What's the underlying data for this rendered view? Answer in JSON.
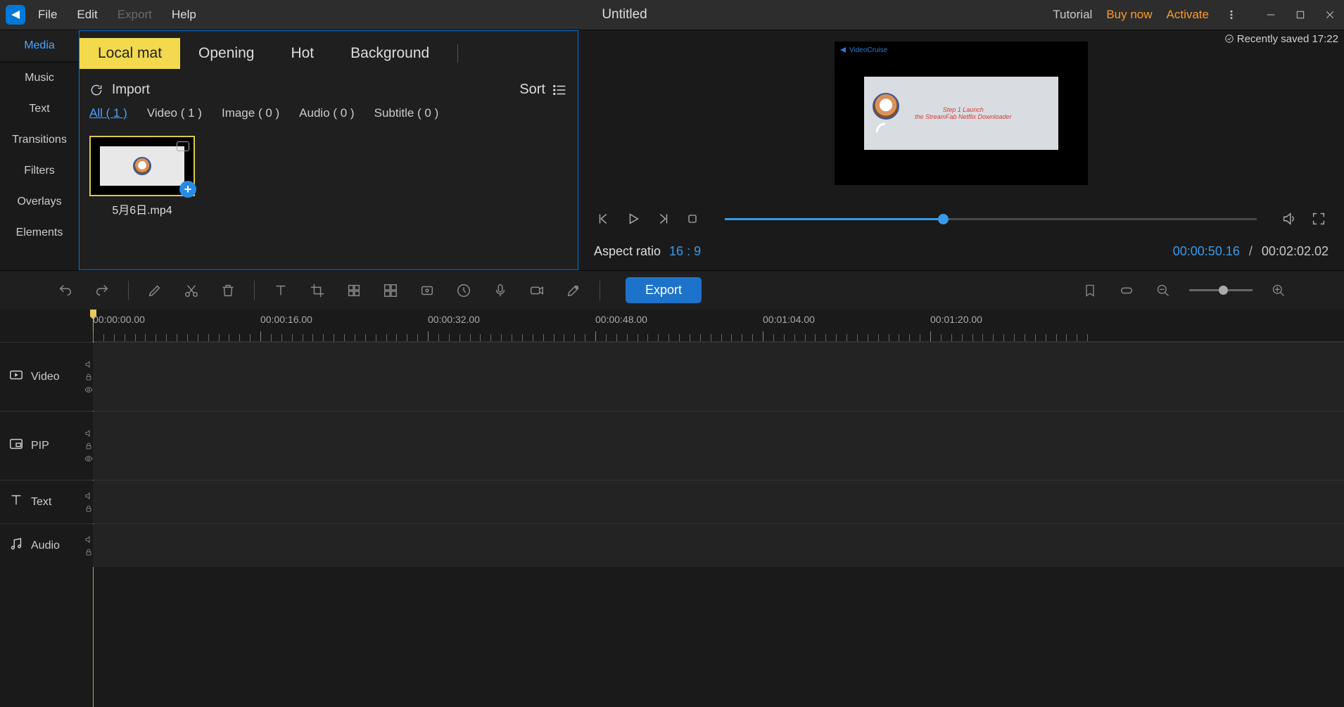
{
  "titlebar": {
    "project_title": "Untitled",
    "menus": [
      "File",
      "Edit",
      "Export",
      "Help"
    ],
    "disabled_menu_index": 2,
    "links": {
      "tutorial": "Tutorial",
      "buy": "Buy now",
      "activate": "Activate"
    }
  },
  "saved_badge": "Recently saved 17:22",
  "sidebar": {
    "tabs": [
      "Media",
      "Music",
      "Text",
      "Transitions",
      "Filters",
      "Overlays",
      "Elements"
    ],
    "active_index": 0
  },
  "media_panel": {
    "source_tabs": [
      "Local mat",
      "Opening",
      "Hot",
      "Background"
    ],
    "active_source": 0,
    "import_label": "Import",
    "sort_label": "Sort",
    "filters": [
      {
        "label": "All ( 1 )",
        "active": true
      },
      {
        "label": "Video ( 1 )",
        "active": false
      },
      {
        "label": "Image ( 0 )",
        "active": false
      },
      {
        "label": "Audio ( 0 )",
        "active": false
      },
      {
        "label": "Subtitle ( 0 )",
        "active": false
      }
    ],
    "items": [
      {
        "name": "5月6日.mp4"
      }
    ]
  },
  "preview": {
    "brand": "VideoCruise",
    "sample_line1": "Step 1 Launch",
    "sample_line2": "the StreamFab Netflix Downloader",
    "aspect_label": "Aspect ratio",
    "aspect_value": "16 : 9",
    "time_current": "00:00:50.16",
    "time_total": "00:02:02.02",
    "progress_pct": 41
  },
  "toolbar": {
    "export_label": "Export"
  },
  "ruler": {
    "marks": [
      "00:00:00.00",
      "00:00:16.00",
      "00:00:32.00",
      "00:00:48.00",
      "00:01:04.00",
      "00:01:20.00"
    ]
  },
  "tracks": [
    {
      "label": "Video",
      "icon": "video",
      "short": false
    },
    {
      "label": "PIP",
      "icon": "pip",
      "short": false
    },
    {
      "label": "Text",
      "icon": "text",
      "short": true
    },
    {
      "label": "Audio",
      "icon": "audio",
      "short": true
    }
  ]
}
